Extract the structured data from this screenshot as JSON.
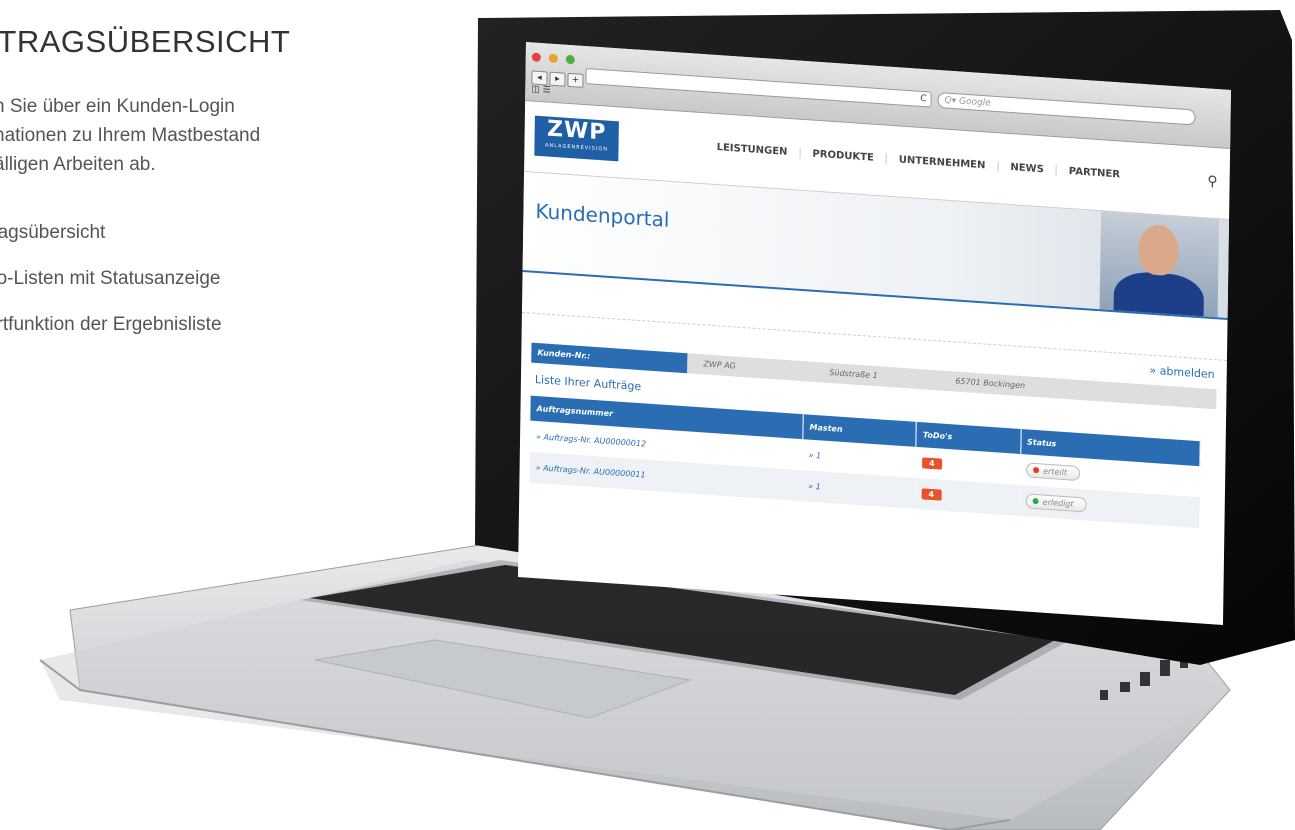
{
  "copy": {
    "title": "FTRAGSÜBERSICHT",
    "intro_lines": [
      "n Sie über ein Kunden-Login",
      "nationen zu Ihrem Mastbestand",
      "älligen Arbeiten ab."
    ],
    "bullets": [
      "tragsübersicht",
      "do-Listen mit Statusanzeige",
      "ortfunktion der Ergebnisliste"
    ]
  },
  "browser": {
    "url_reload": "C",
    "search_placeholder": "Q▾ Google",
    "back": "◂",
    "forward": "▸",
    "add_tab": "+",
    "bookmarks": "◫ ☰"
  },
  "site": {
    "logo_mark": "ZWP",
    "logo_sub": "ANLAGENREVISION",
    "nav": [
      "LEISTUNGEN",
      "PRODUKTE",
      "UNTERNEHMEN",
      "NEWS",
      "PARTNER"
    ],
    "search_icon": "⚲",
    "banner_title": "Kundenportal",
    "logout": "» abmelden"
  },
  "customer": {
    "label": "Kunden-Nr.:",
    "name": "ZWP AG",
    "street": "Südstraße 1",
    "city": "65701 Bockingen"
  },
  "orders": {
    "heading": "Liste Ihrer Aufträge",
    "columns": [
      "Auftragsnummer",
      "Masten",
      "ToDo's",
      "Status"
    ],
    "rows": [
      {
        "order": "» Auftrags-Nr. AU00000012",
        "masts": "» 1",
        "todos": "4",
        "status": "erteilt",
        "status_color": "#e53b2c"
      },
      {
        "order": "» Auftrags-Nr. AU00000011",
        "masts": "» 1",
        "todos": "4",
        "status": "erledigt",
        "status_color": "#2fa84a"
      }
    ]
  },
  "colors": {
    "brand": "#2a6db3",
    "todo": "#e8532b"
  }
}
